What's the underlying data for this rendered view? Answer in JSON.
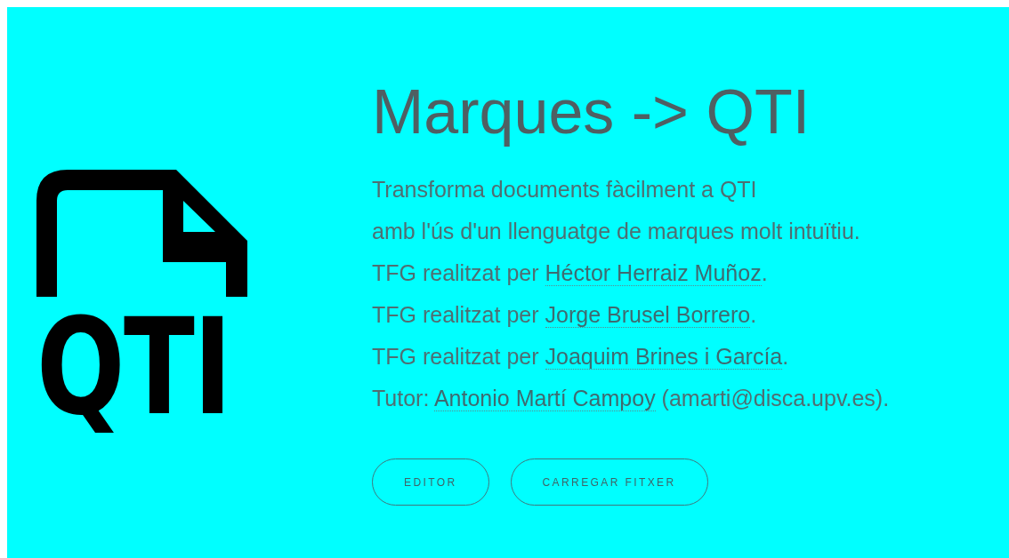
{
  "logo": {
    "text": "QTI"
  },
  "title": "Marques -> QTI",
  "lines": [
    {
      "kind": "text",
      "text": "Transforma documents fàcilment a QTI"
    },
    {
      "kind": "text",
      "text": "amb l'ús d'un llenguatge de marques molt intuïtiu."
    },
    {
      "kind": "credit",
      "prefix": "TFG realitzat per ",
      "link": "Héctor Herraiz Muñoz",
      "suffix": "."
    },
    {
      "kind": "credit",
      "prefix": "TFG realitzat per ",
      "link": "Jorge Brusel Borrero",
      "suffix": "."
    },
    {
      "kind": "credit",
      "prefix": "TFG realitzat per ",
      "link": "Joaquim Brines i García",
      "suffix": "."
    },
    {
      "kind": "credit",
      "prefix": "Tutor: ",
      "link": "Antonio Martí Campoy",
      "suffix": " (amarti@disca.upv.es)."
    }
  ],
  "buttons": [
    "EDITOR",
    "CARREGAR FITXER"
  ]
}
